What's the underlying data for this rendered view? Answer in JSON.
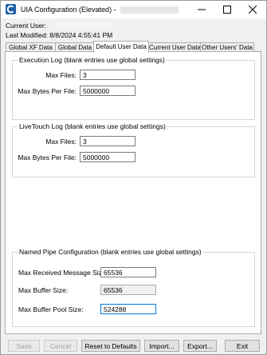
{
  "window": {
    "title": "UIA Configuration (Elevated) -",
    "icon_letter": "C"
  },
  "info": {
    "current_user_label": "Current User:",
    "last_modified": "Last Modified: 8/8/2024 4:55:41 PM"
  },
  "tabs": [
    {
      "label": "Global XF Data"
    },
    {
      "label": "Global Data"
    },
    {
      "label": "Default User Data",
      "active": true
    },
    {
      "label": "Current User Data"
    },
    {
      "label": "Other Users' Data"
    }
  ],
  "execution_log": {
    "title": "Execution Log (blank entries use global settings)",
    "max_files_label": "Max Files:",
    "max_files": "3",
    "max_bytes_label": "Max Bytes Per File:",
    "max_bytes": "5000000"
  },
  "livetouch_log": {
    "title": "LiveTouch Log (blank entries use global settings)",
    "max_files_label": "Max Files:",
    "max_files": "3",
    "max_bytes_label": "Max Bytes Per File:",
    "max_bytes": "5000000"
  },
  "named_pipe": {
    "title": "Named Pipe Configuration (blank entries use global settings)",
    "max_received_label": "Max Received Message Size:",
    "max_received": "65536",
    "max_buffer_label": "Max Buffer Size:",
    "max_buffer": "65536",
    "max_pool_label": "Max Buffer Pool Size:",
    "max_pool": "524288"
  },
  "buttons": {
    "save": "Save",
    "cancel": "Cancel",
    "reset": "Reset to Defaults",
    "import": "Import...",
    "export": "Export...",
    "exit": "Exit"
  },
  "colors": {
    "title_bar": "#ffffff",
    "window_bg": "#f0f0f0",
    "panel_bg": "#ffffff",
    "app_icon": "#1f5ea8",
    "focus_border": "#0078d7"
  }
}
